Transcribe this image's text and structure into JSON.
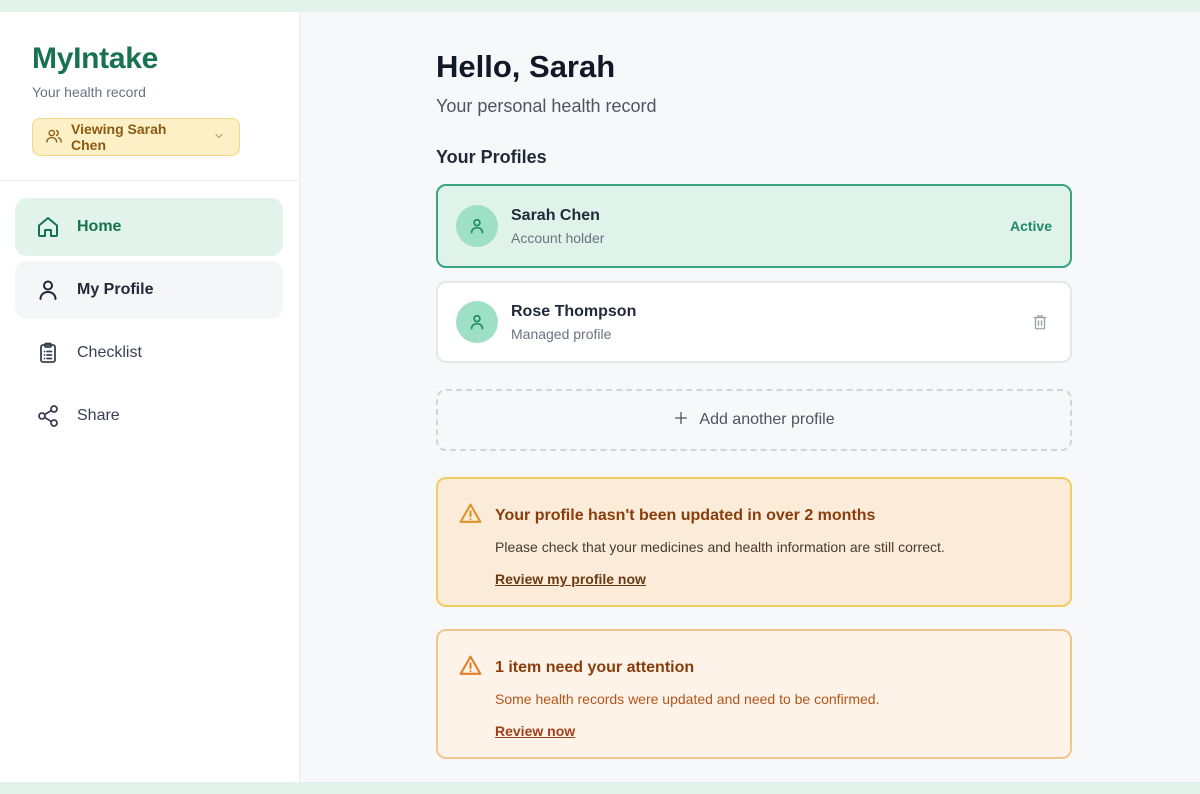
{
  "brand": {
    "title": "MyIntake",
    "subtitle": "Your health record"
  },
  "viewing": {
    "label": "Viewing Sarah Chen",
    "icon": "users-icon"
  },
  "nav": {
    "items": [
      {
        "label": "Home",
        "icon": "home-icon",
        "state": "active"
      },
      {
        "label": "My Profile",
        "icon": "user-icon",
        "state": "hover"
      },
      {
        "label": "Checklist",
        "icon": "clipboard-icon",
        "state": "default"
      },
      {
        "label": "Share",
        "icon": "share-icon",
        "state": "default"
      }
    ]
  },
  "header": {
    "greeting": "Hello, Sarah",
    "subtitle": "Your personal health record"
  },
  "profiles": {
    "section_title": "Your Profiles",
    "items": [
      {
        "name": "Sarah Chen",
        "role": "Account holder",
        "status": "Active"
      },
      {
        "name": "Rose Thompson",
        "role": "Managed profile"
      }
    ],
    "add_label": "Add another profile"
  },
  "alerts": [
    {
      "title": "Your profile hasn't been updated in over 2 months",
      "body": "Please check that your medicines and health information are still correct.",
      "link": "Review my profile now"
    },
    {
      "title": "1 item need your attention",
      "body": "Some health records were updated and need to be confirmed.",
      "link": "Review now"
    }
  ],
  "colors": {
    "brand": "#17734f",
    "active_bg": "#e1f3ea",
    "warning_border": "#f2cc5f",
    "attention_border": "#f3c48f"
  }
}
